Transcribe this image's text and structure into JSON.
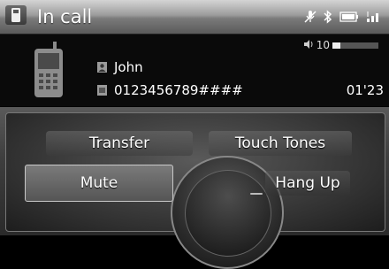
{
  "header": {
    "title": "In call",
    "icons": [
      "phone-tab-icon",
      "mute-mic-icon",
      "bluetooth-icon",
      "battery-icon",
      "signal-icon"
    ]
  },
  "call": {
    "volume_label": "10",
    "volume_level": 0.18,
    "contact_name": "John",
    "contact_number": "0123456789####",
    "duration": "01'23"
  },
  "controls": {
    "transfer_label": "Transfer",
    "touch_tones_label": "Touch Tones",
    "mute_label": "Mute",
    "hang_up_label": "Hang Up"
  },
  "colors": {
    "titlebar": "#9c9c9c",
    "background": "#000000",
    "selected_border": "#c8c8c8"
  }
}
